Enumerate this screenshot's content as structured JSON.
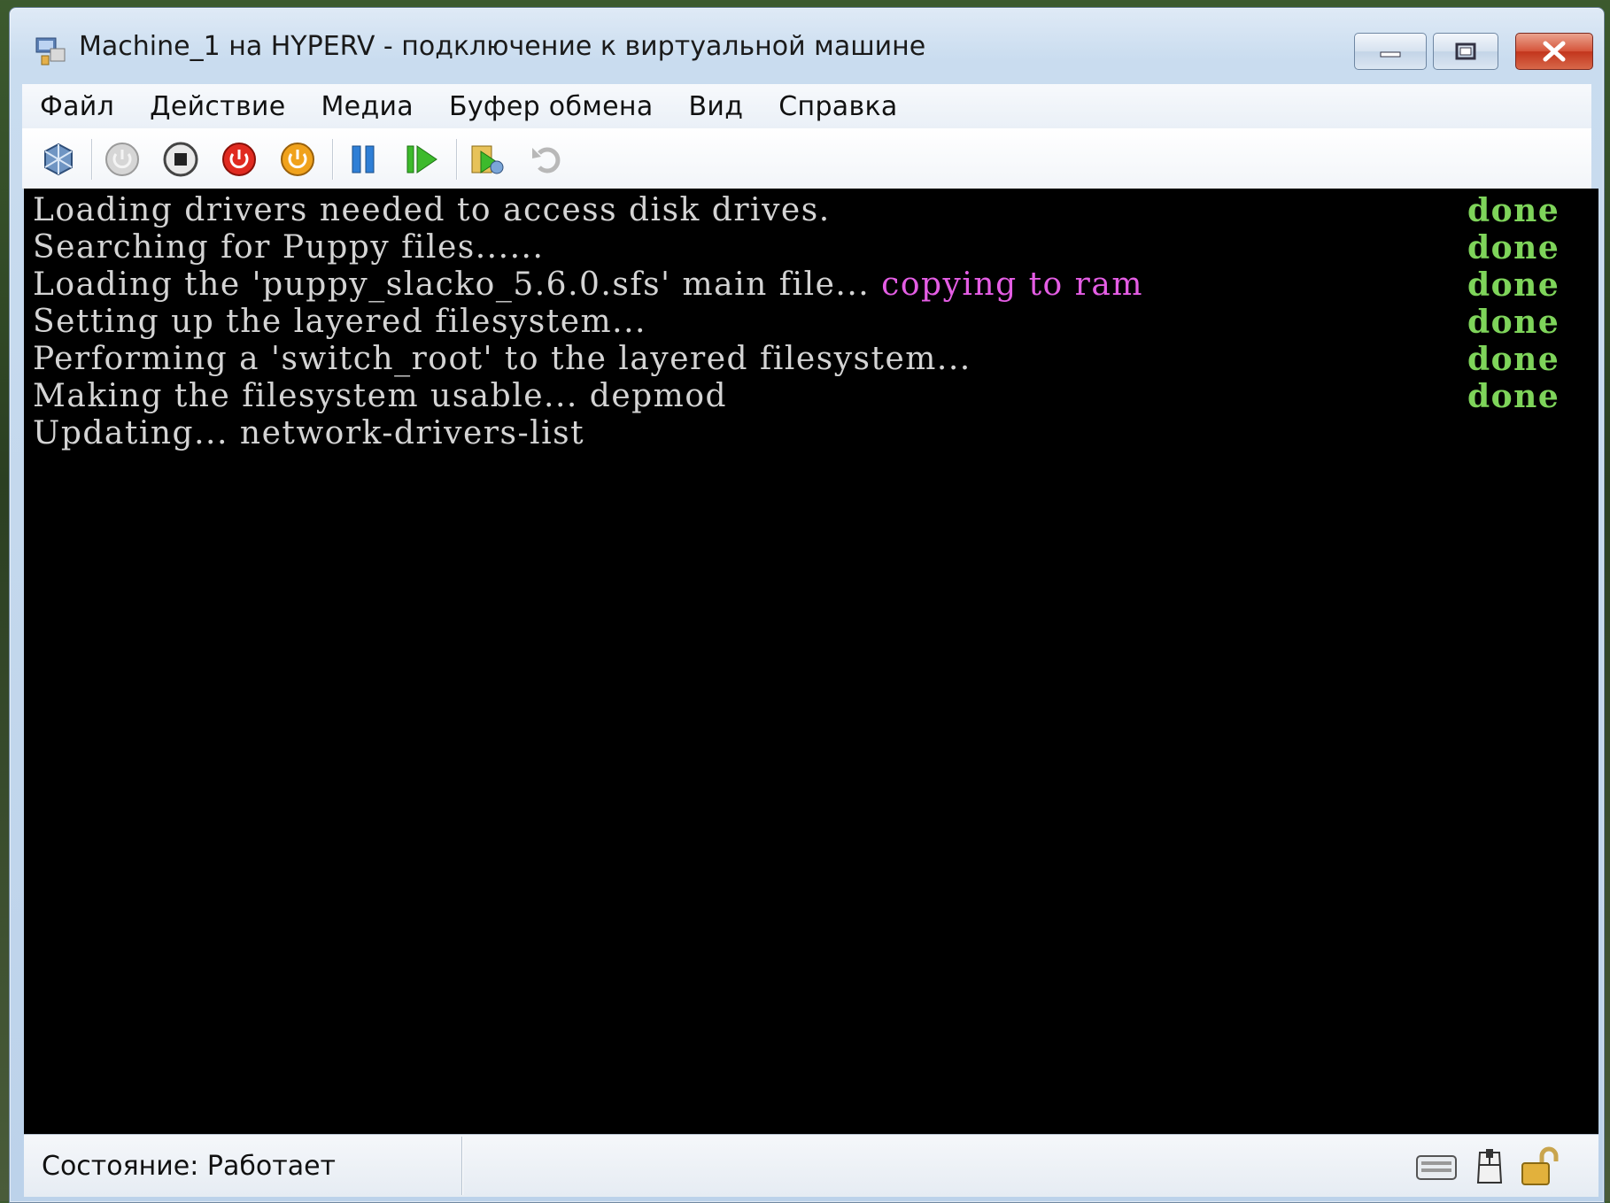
{
  "window": {
    "title": "Machine_1 на HYPERV - подключение к виртуальной машине"
  },
  "menu": [
    "Файл",
    "Действие",
    "Медиа",
    "Буфер обмена",
    "Вид",
    "Справка"
  ],
  "toolbar": {
    "icons": [
      "ctrl-alt-del-icon",
      "start-icon",
      "turn-off-icon",
      "shut-down-icon",
      "save-state-icon",
      "pause-icon",
      "resume-icon",
      "snapshot-icon",
      "revert-icon"
    ]
  },
  "console": {
    "lines": [
      {
        "text": "Loading drivers needed to access disk drives.",
        "extra": "",
        "status": "done"
      },
      {
        "text": "Searching for Puppy files......",
        "extra": "",
        "status": "done"
      },
      {
        "text": "Loading the 'puppy_slacko_5.6.0.sfs' main file... ",
        "extra": "copying to ram",
        "status": "done"
      },
      {
        "text": "Setting up the layered filesystem...",
        "extra": "",
        "status": "done"
      },
      {
        "text": "Performing a 'switch_root' to the layered filesystem...",
        "extra": "",
        "status": "done"
      },
      {
        "text": "Making the filesystem usable... depmod",
        "extra": "",
        "status": "done"
      },
      {
        "text": "Updating... network-drivers-list",
        "extra": "",
        "status": ""
      }
    ],
    "colors": {
      "background": "#000000",
      "text": "#d4d4d4",
      "done": "#7ed45a",
      "highlight": "#e45de4"
    }
  },
  "statusbar": {
    "state": "Состояние: Работает",
    "icons": [
      "keyboard-icon",
      "mouse-icon",
      "lock-icon"
    ]
  }
}
